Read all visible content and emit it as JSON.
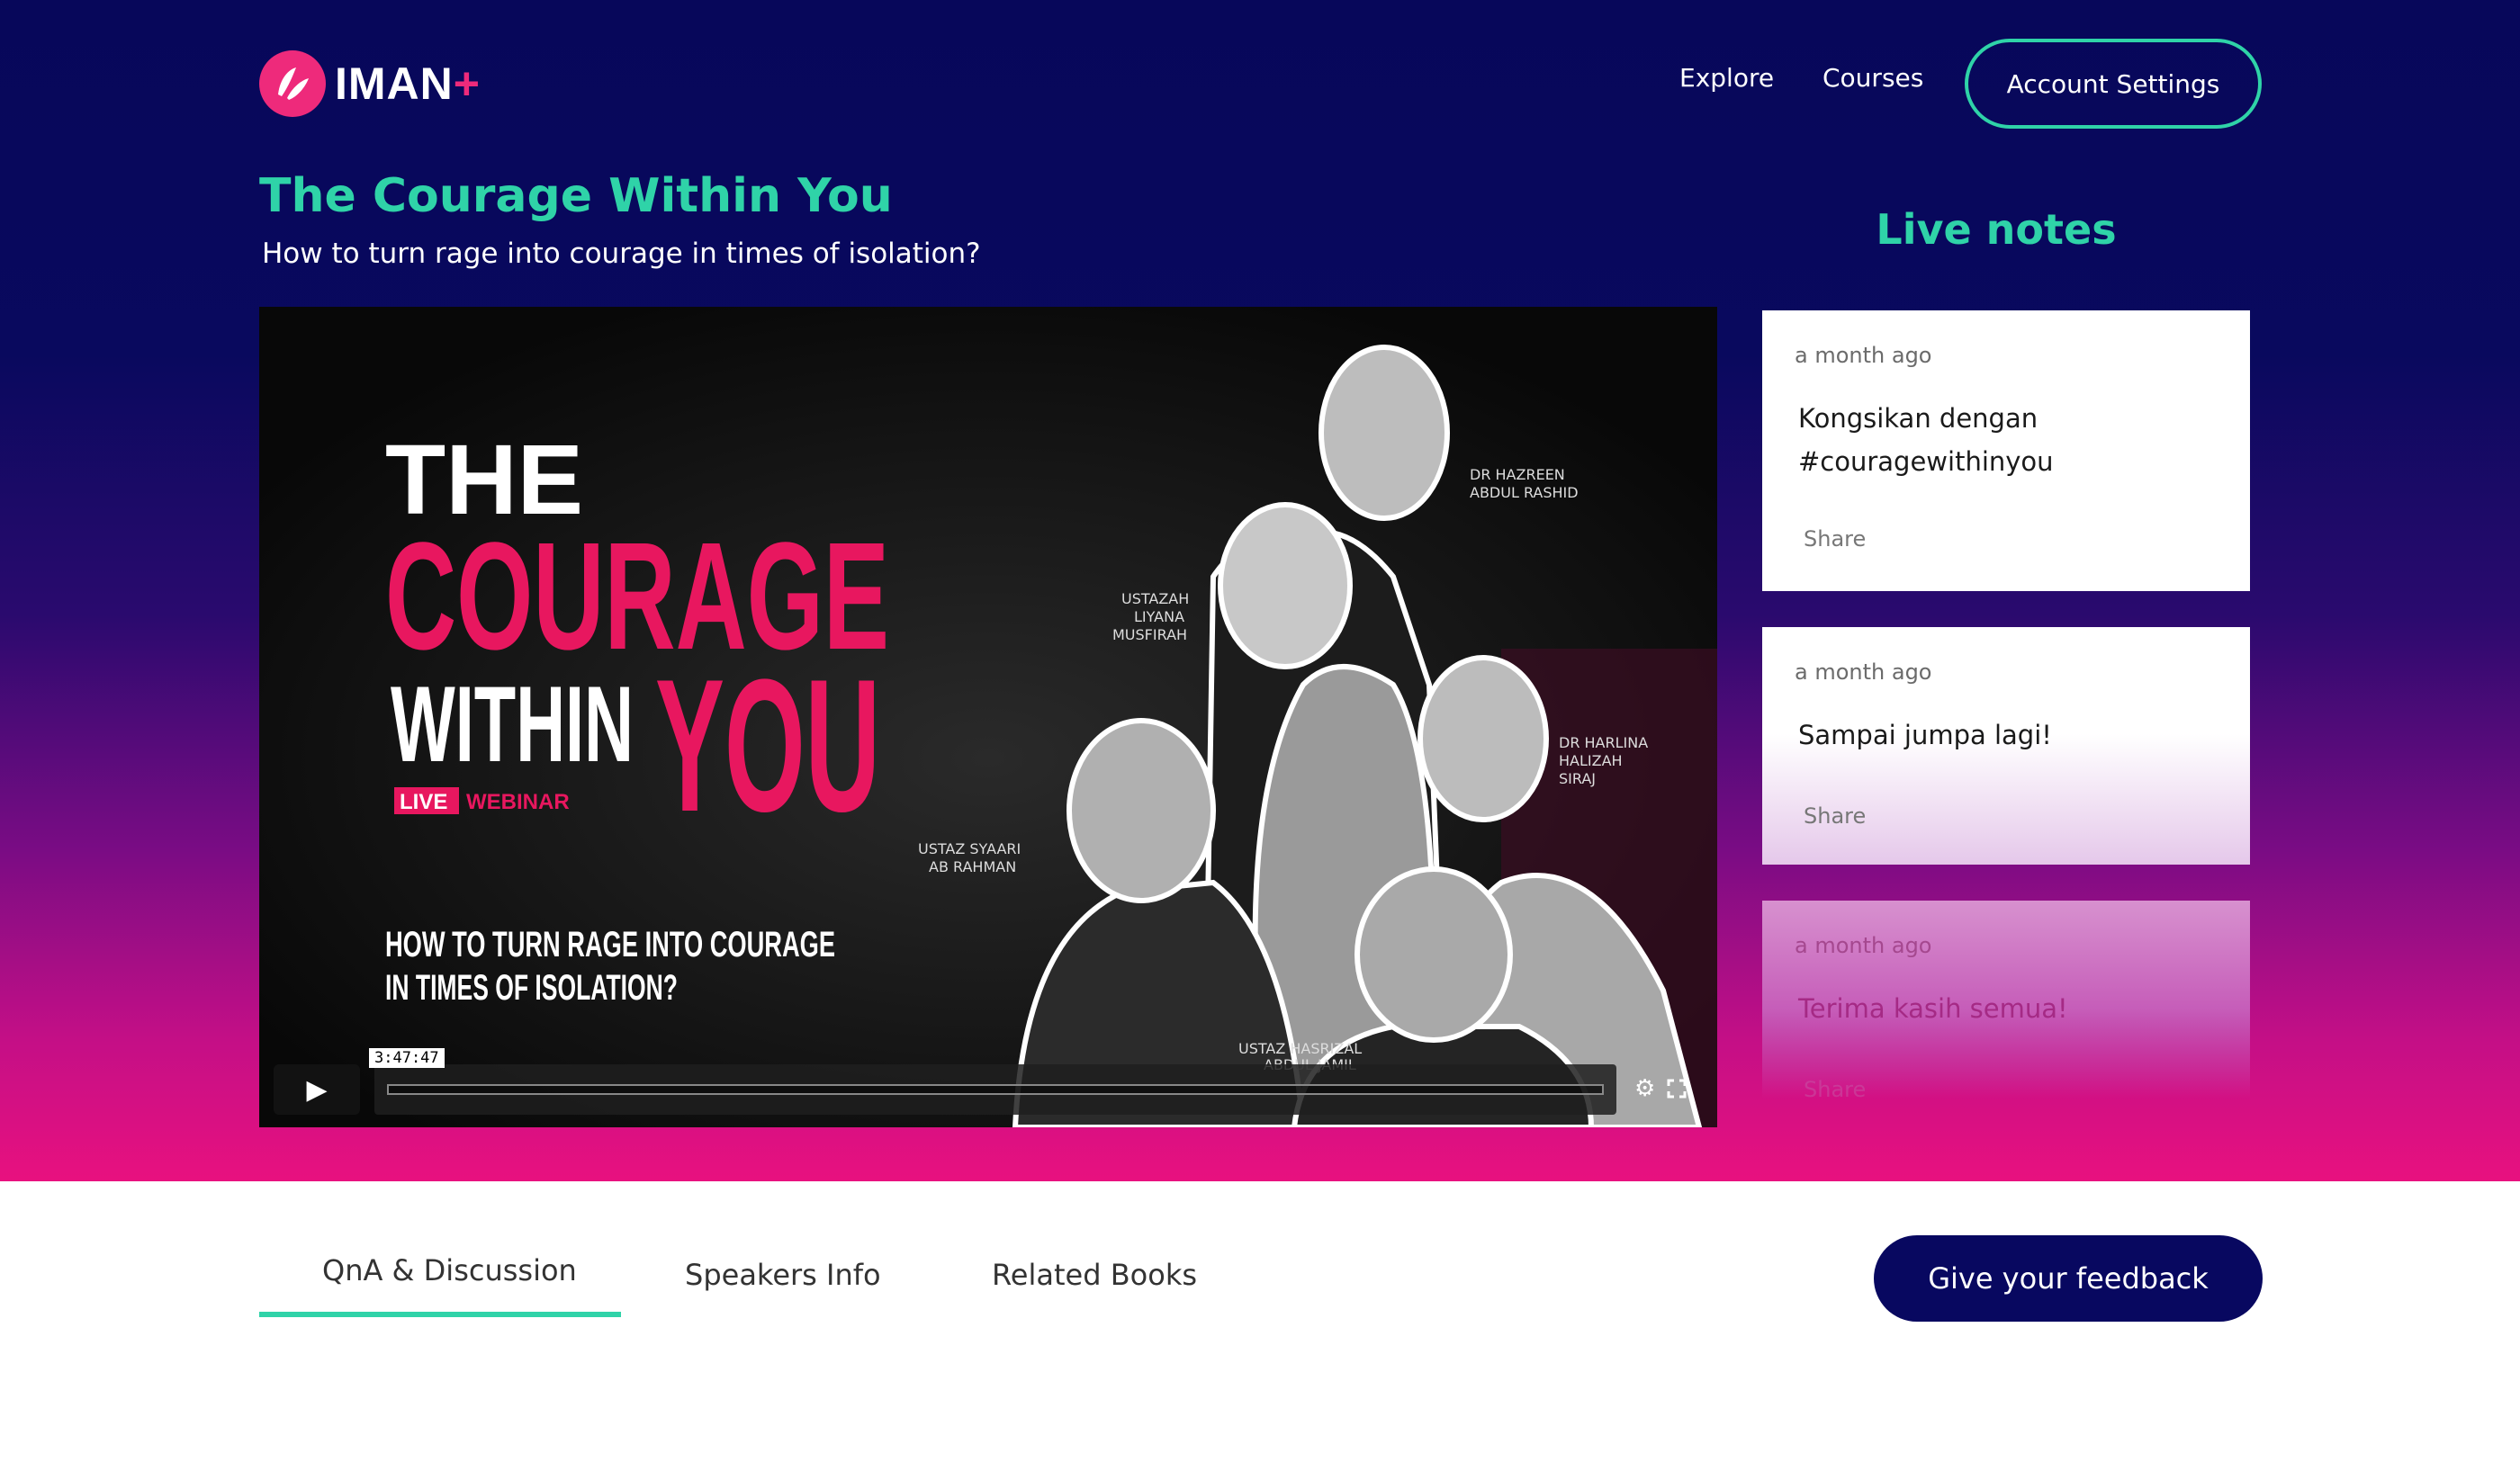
{
  "brand": {
    "name": "IMAN",
    "plus": "+",
    "accent": "#ee2a7b",
    "teal": "#2fd3a8",
    "navy": "#080860"
  },
  "nav": {
    "explore": "Explore",
    "courses": "Courses",
    "account_settings": "Account Settings"
  },
  "hero": {
    "title": "The Courage Within You",
    "subtitle": "How to turn rage into courage in times of isolation?"
  },
  "video": {
    "poster": {
      "headline_1": "THE",
      "headline_2": "COURAGE",
      "headline_3": "WITHIN",
      "headline_4": "YOU",
      "badge_live": "LIVE",
      "badge_webinar": "WEBINAR",
      "tagline_1": "HOW TO TURN RAGE INTO COURAGE",
      "tagline_2": "IN TIMES OF ISOLATION?",
      "speakers": [
        {
          "line1": "DR HAZREEN",
          "line2": "ABDUL RASHID",
          "line3": ""
        },
        {
          "line1": "USTAZAH",
          "line2": "LIYANA",
          "line3": "MUSFIRAH"
        },
        {
          "line1": "DR HARLINA",
          "line2": "HALIZAH",
          "line3": "SIRAJ"
        },
        {
          "line1": "USTAZ SYAARI",
          "line2": "AB RAHMAN",
          "line3": ""
        },
        {
          "line1": "USTAZ HASRIZAL",
          "line2": "ABDUL JAMIL",
          "line3": ""
        }
      ]
    },
    "duration": "3:47:47",
    "progress": 0.0,
    "icons": {
      "play": "play-icon",
      "settings": "gear-icon",
      "fullscreen": "fullscreen-icon"
    }
  },
  "live_notes": {
    "title": "Live notes",
    "notes": [
      {
        "time": "a month ago",
        "text": "Kongsikan dengan #couragewithinyou",
        "share": "Share"
      },
      {
        "time": "a month ago",
        "text": "Sampai jumpa lagi!",
        "share": "Share"
      },
      {
        "time": "a month ago",
        "text": "Terima kasih semua!",
        "share": "Share"
      }
    ]
  },
  "tabs": {
    "qna": "QnA & Discussion",
    "speakers": "Speakers Info",
    "books": "Related Books",
    "active": "QnA & Discussion"
  },
  "feedback_button": "Give your feedback"
}
